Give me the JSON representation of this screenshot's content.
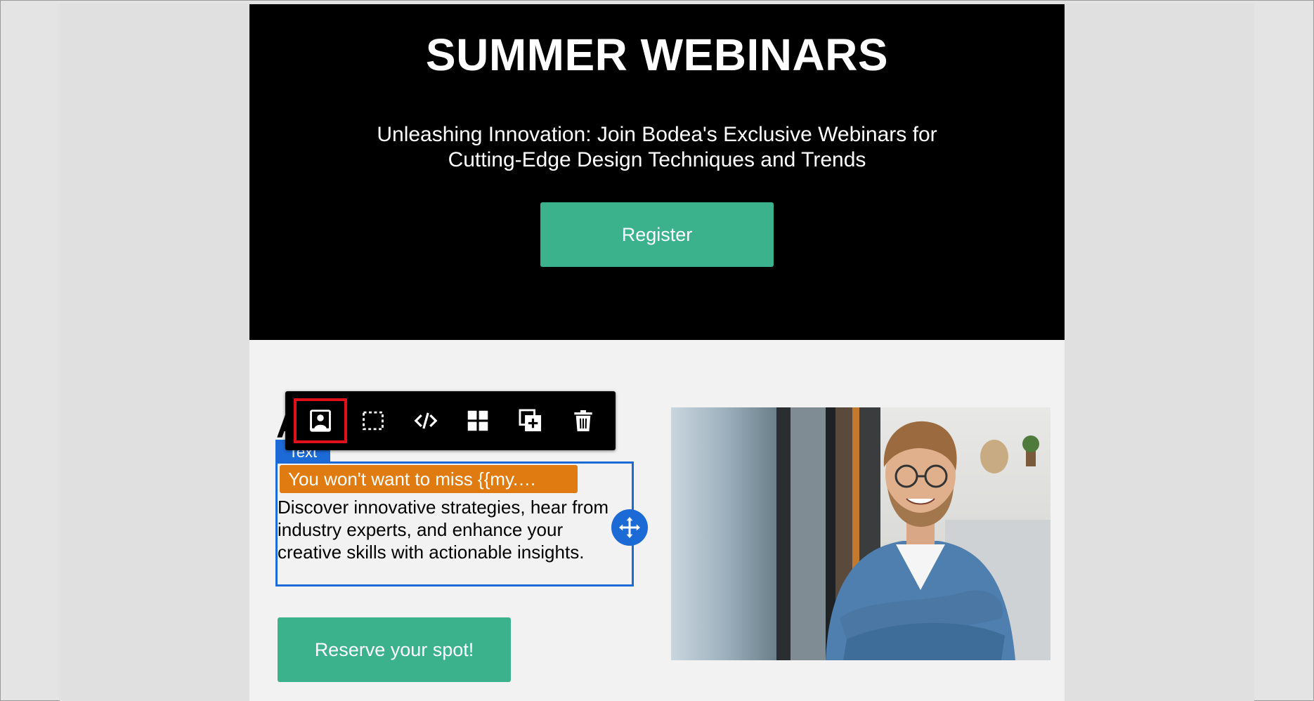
{
  "hero": {
    "title": "SUMMER WEBINARS",
    "subtitle": "Unleashing Innovation: Join Bodea's Exclusive Webinars for Cutting-Edge Design Techniques and Trends",
    "register_label": "Register"
  },
  "content": {
    "heading_partial": "A",
    "selection_label": "Text",
    "variable_pill": "You won't want to miss {{my.…",
    "body_text": "Discover innovative strategies, hear from industry experts, and enhance your creative skills with actionable insights.",
    "reserve_label": "Reserve your spot!"
  },
  "toolbar": {
    "tools": [
      {
        "icon": "save-as-snippet-icon"
      },
      {
        "icon": "select-parent-icon"
      },
      {
        "icon": "code-icon"
      },
      {
        "icon": "layout-grid-icon"
      },
      {
        "icon": "duplicate-icon"
      },
      {
        "icon": "delete-icon"
      }
    ]
  },
  "colors": {
    "hero_bg": "#000000",
    "button_green": "#3bb28b",
    "selection_blue": "#1c6ad6",
    "variable_orange": "#e07b12",
    "highlight_red": "#e0101a"
  }
}
